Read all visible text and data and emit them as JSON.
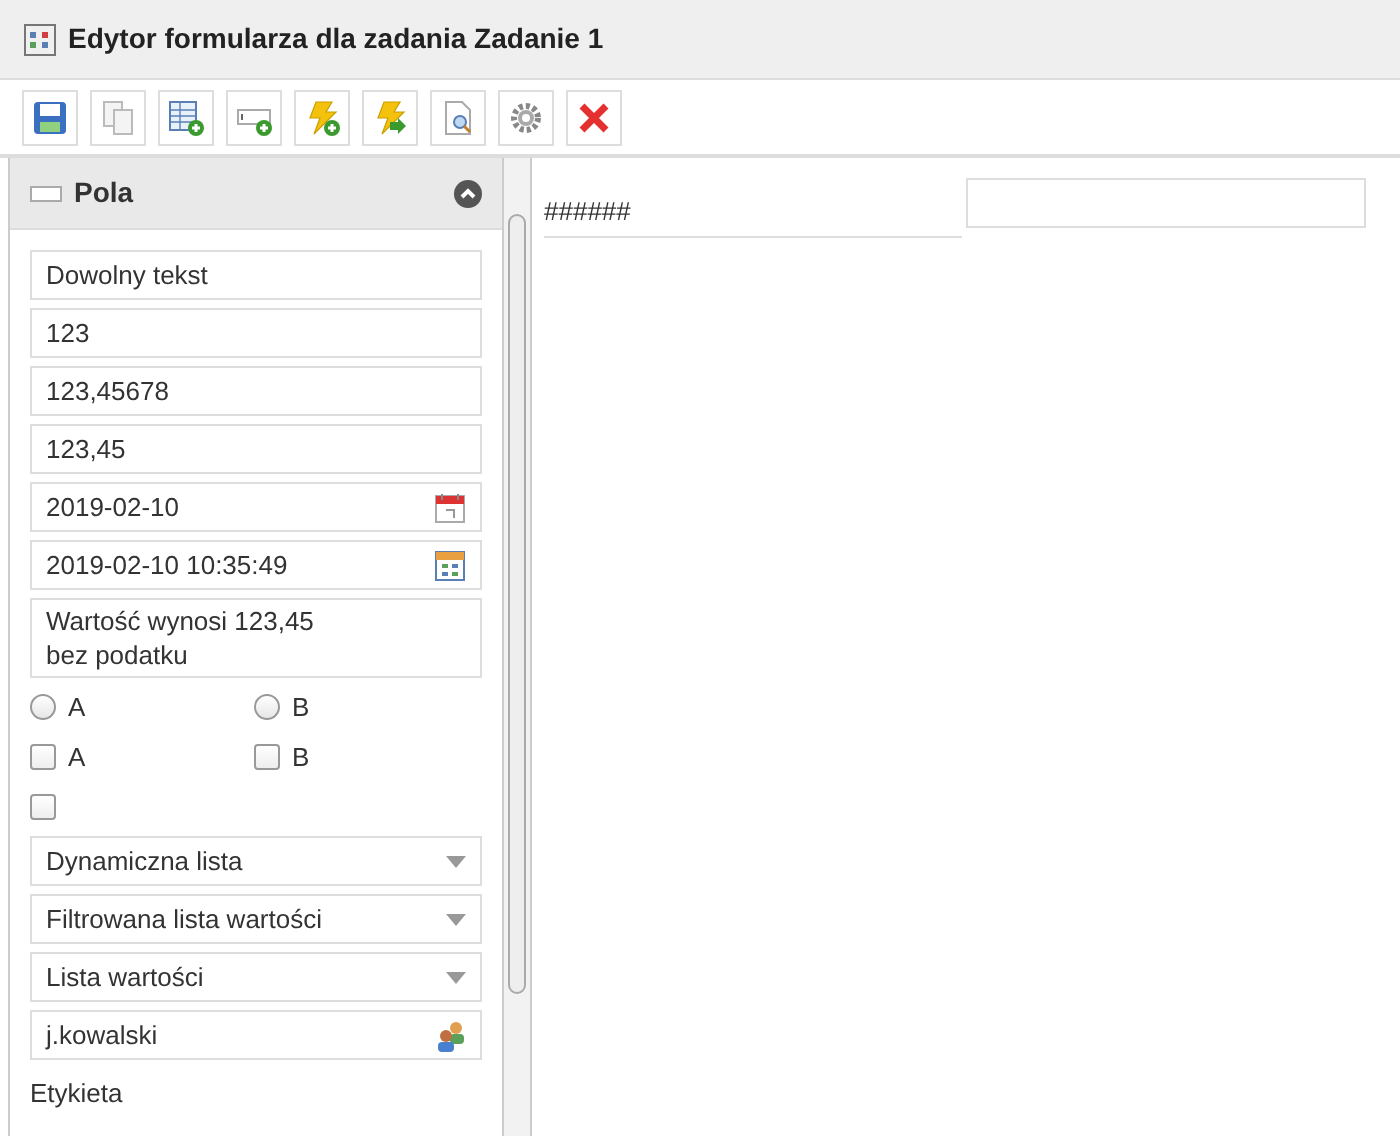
{
  "window": {
    "title": "Edytor formularza dla zadania Zadanie 1"
  },
  "panel": {
    "title": "Pola",
    "expanded": true,
    "fields": [
      {
        "kind": "text",
        "value": "Dowolny tekst"
      },
      {
        "kind": "text",
        "value": "123"
      },
      {
        "kind": "text",
        "value": "123,45678"
      },
      {
        "kind": "text",
        "value": "123,45"
      },
      {
        "kind": "date",
        "value": "2019-02-10"
      },
      {
        "kind": "datetime",
        "value": "2019-02-10 10:35:49"
      },
      {
        "kind": "textarea",
        "value": "Wartość wynosi 123,45\nbez podatku"
      },
      {
        "kind": "radio",
        "options": [
          {
            "label": "A",
            "checked": false
          },
          {
            "label": "B",
            "checked": false
          }
        ]
      },
      {
        "kind": "checkbox",
        "options": [
          {
            "label": "A",
            "checked": false
          },
          {
            "label": "B",
            "checked": false
          }
        ]
      },
      {
        "kind": "checkbox",
        "options": [
          {
            "checked": false
          }
        ]
      },
      {
        "kind": "select",
        "value": "Dynamiczna lista"
      },
      {
        "kind": "select",
        "value": "Filtrowana lista wartości"
      },
      {
        "kind": "select",
        "value": "Lista wartości"
      },
      {
        "kind": "user",
        "value": "j.kowalski"
      },
      {
        "kind": "label",
        "value": "Etykieta"
      }
    ]
  },
  "canvas": {
    "label": "######"
  }
}
